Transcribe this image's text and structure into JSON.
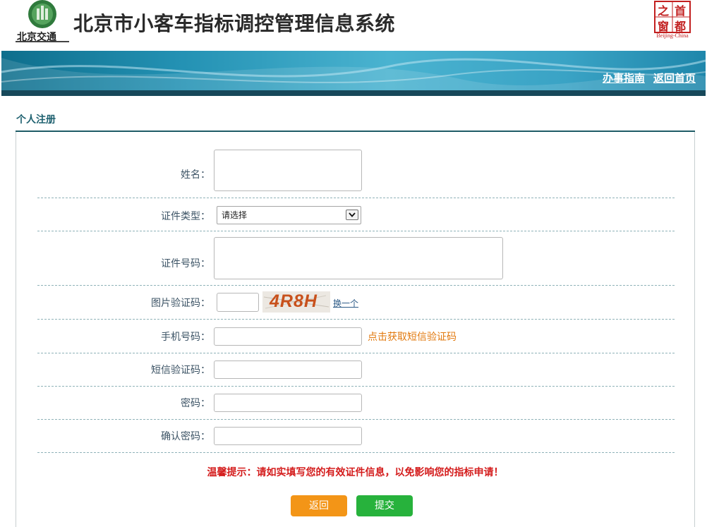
{
  "header": {
    "title": "北京市小客车指标调控管理信息系统",
    "logo_text": "北京交通",
    "seal_chars": [
      "之",
      "首",
      "窗",
      "都"
    ],
    "seal_caption": "Beijing-China"
  },
  "nav": {
    "guide": "办事指南",
    "home": "返回首页"
  },
  "section": {
    "title": "个人注册"
  },
  "form": {
    "name_label": "姓名：",
    "id_type_label": "证件类型：",
    "id_type_value": "请选择",
    "id_number_label": "证件号码：",
    "captcha_label": "图片验证码：",
    "captcha_text": "4R8H",
    "captcha_refresh": "换一个",
    "phone_label": "手机号码：",
    "sms_link": "点击获取短信验证码",
    "sms_code_label": "短信验证码：",
    "password_label": "密码：",
    "confirm_label": "确认密码："
  },
  "tip": "温馨提示：请如实填写您的有效证件信息，以免影响您的指标申请！",
  "buttons": {
    "back": "返回",
    "submit": "提交"
  },
  "colors": {
    "accent_teal": "#1f5c66",
    "tip_red": "#d41c1c",
    "back_orange": "#f39517",
    "submit_green": "#27b23c",
    "sms_orange": "#e2790e"
  }
}
